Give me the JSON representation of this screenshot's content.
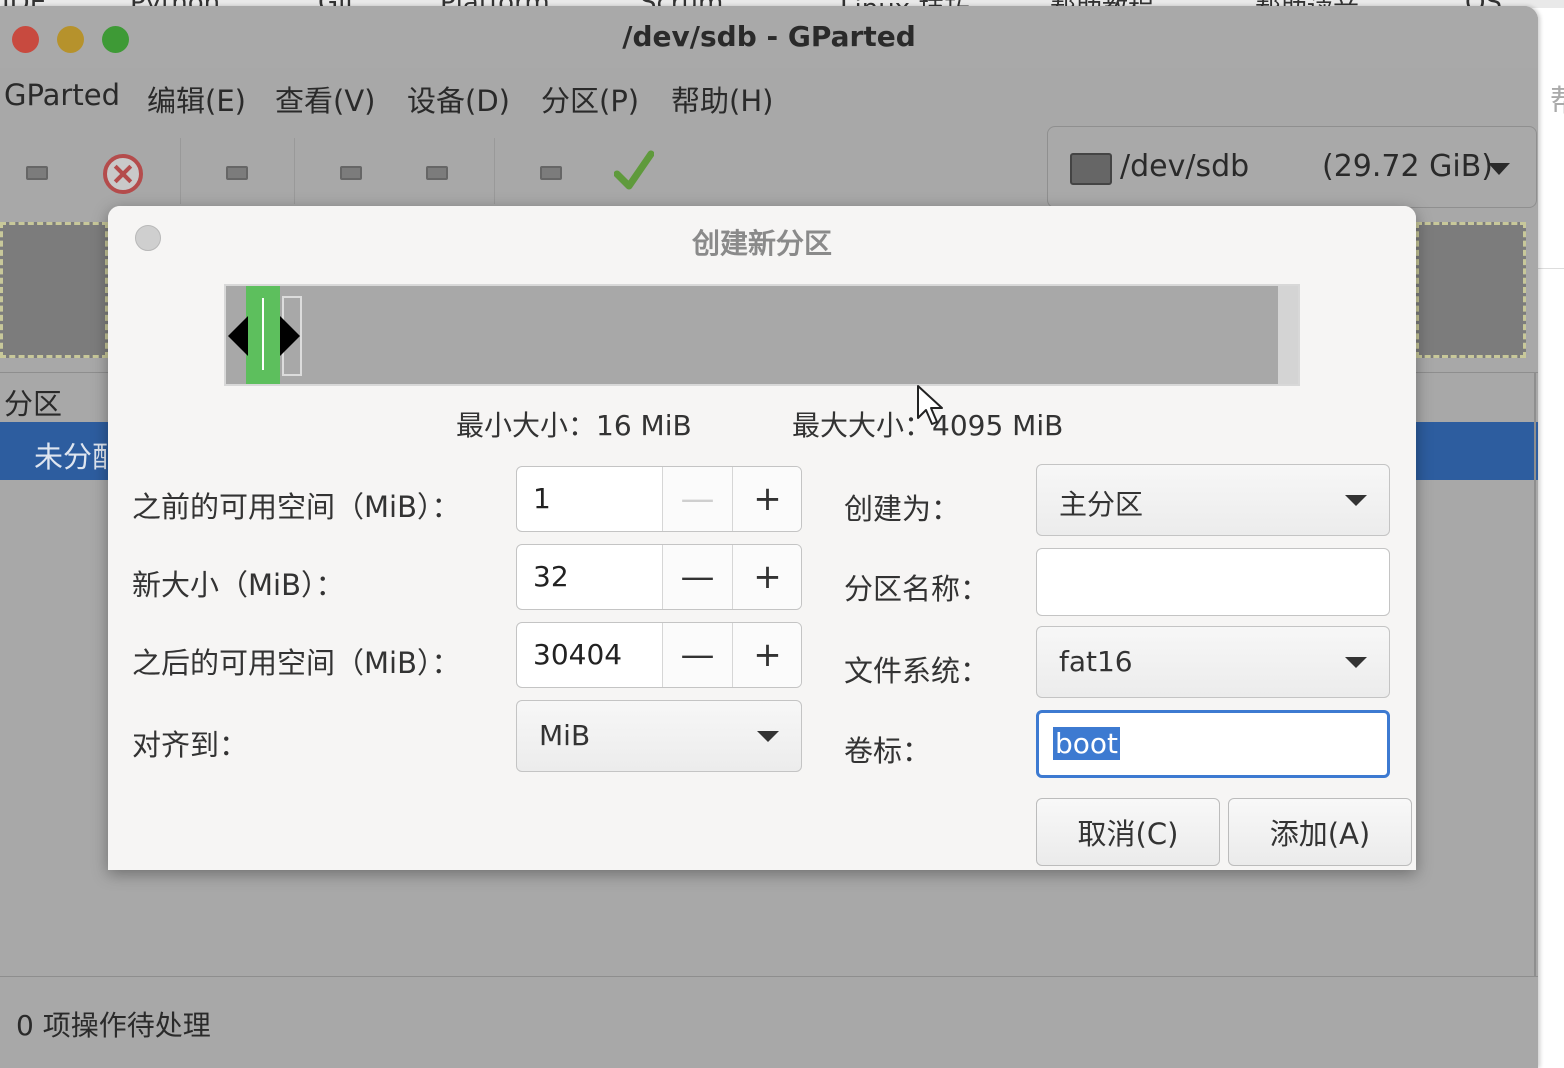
{
  "background": {
    "bookmarks": [
      "IDE",
      "Python",
      "Git",
      "Platform",
      "Scrum",
      "Linux 技巧",
      "帮助教程",
      "帮助读音",
      "OS"
    ],
    "right_edge_text": "帮"
  },
  "window": {
    "title": "/dev/sdb - GParted"
  },
  "menubar": {
    "items": [
      "GParted",
      "编辑(E)",
      "查看(V)",
      "设备(D)",
      "分区(P)",
      "帮助(H)"
    ]
  },
  "toolbar": {
    "device": {
      "path": "/dev/sdb",
      "size": "(29.72 GiB)"
    }
  },
  "partition_list": {
    "header": "分区",
    "rows": [
      {
        "name": "未分配"
      }
    ]
  },
  "statusbar": {
    "text": "0 项操作待处理"
  },
  "dialog": {
    "title": "创建新分区",
    "min_size": "最小大小：16 MiB",
    "max_size": "最大大小：4095 MiB",
    "fields": {
      "free_before": {
        "label": "之前的可用空间（MiB）：",
        "value": "1"
      },
      "new_size": {
        "label": "新大小（MiB）：",
        "value": "32"
      },
      "free_after": {
        "label": "之后的可用空间（MiB）：",
        "value": "30404"
      },
      "align": {
        "label": "对齐到：",
        "value": "MiB"
      },
      "create_as": {
        "label": "创建为：",
        "value": "主分区"
      },
      "partition_name": {
        "label": "分区名称：",
        "value": ""
      },
      "filesystem": {
        "label": "文件系统：",
        "value": "fat16"
      },
      "volume_label": {
        "label": "卷标：",
        "value": "boot"
      }
    },
    "buttons": {
      "cancel": "取消(C)",
      "add": "添加(A)"
    }
  }
}
